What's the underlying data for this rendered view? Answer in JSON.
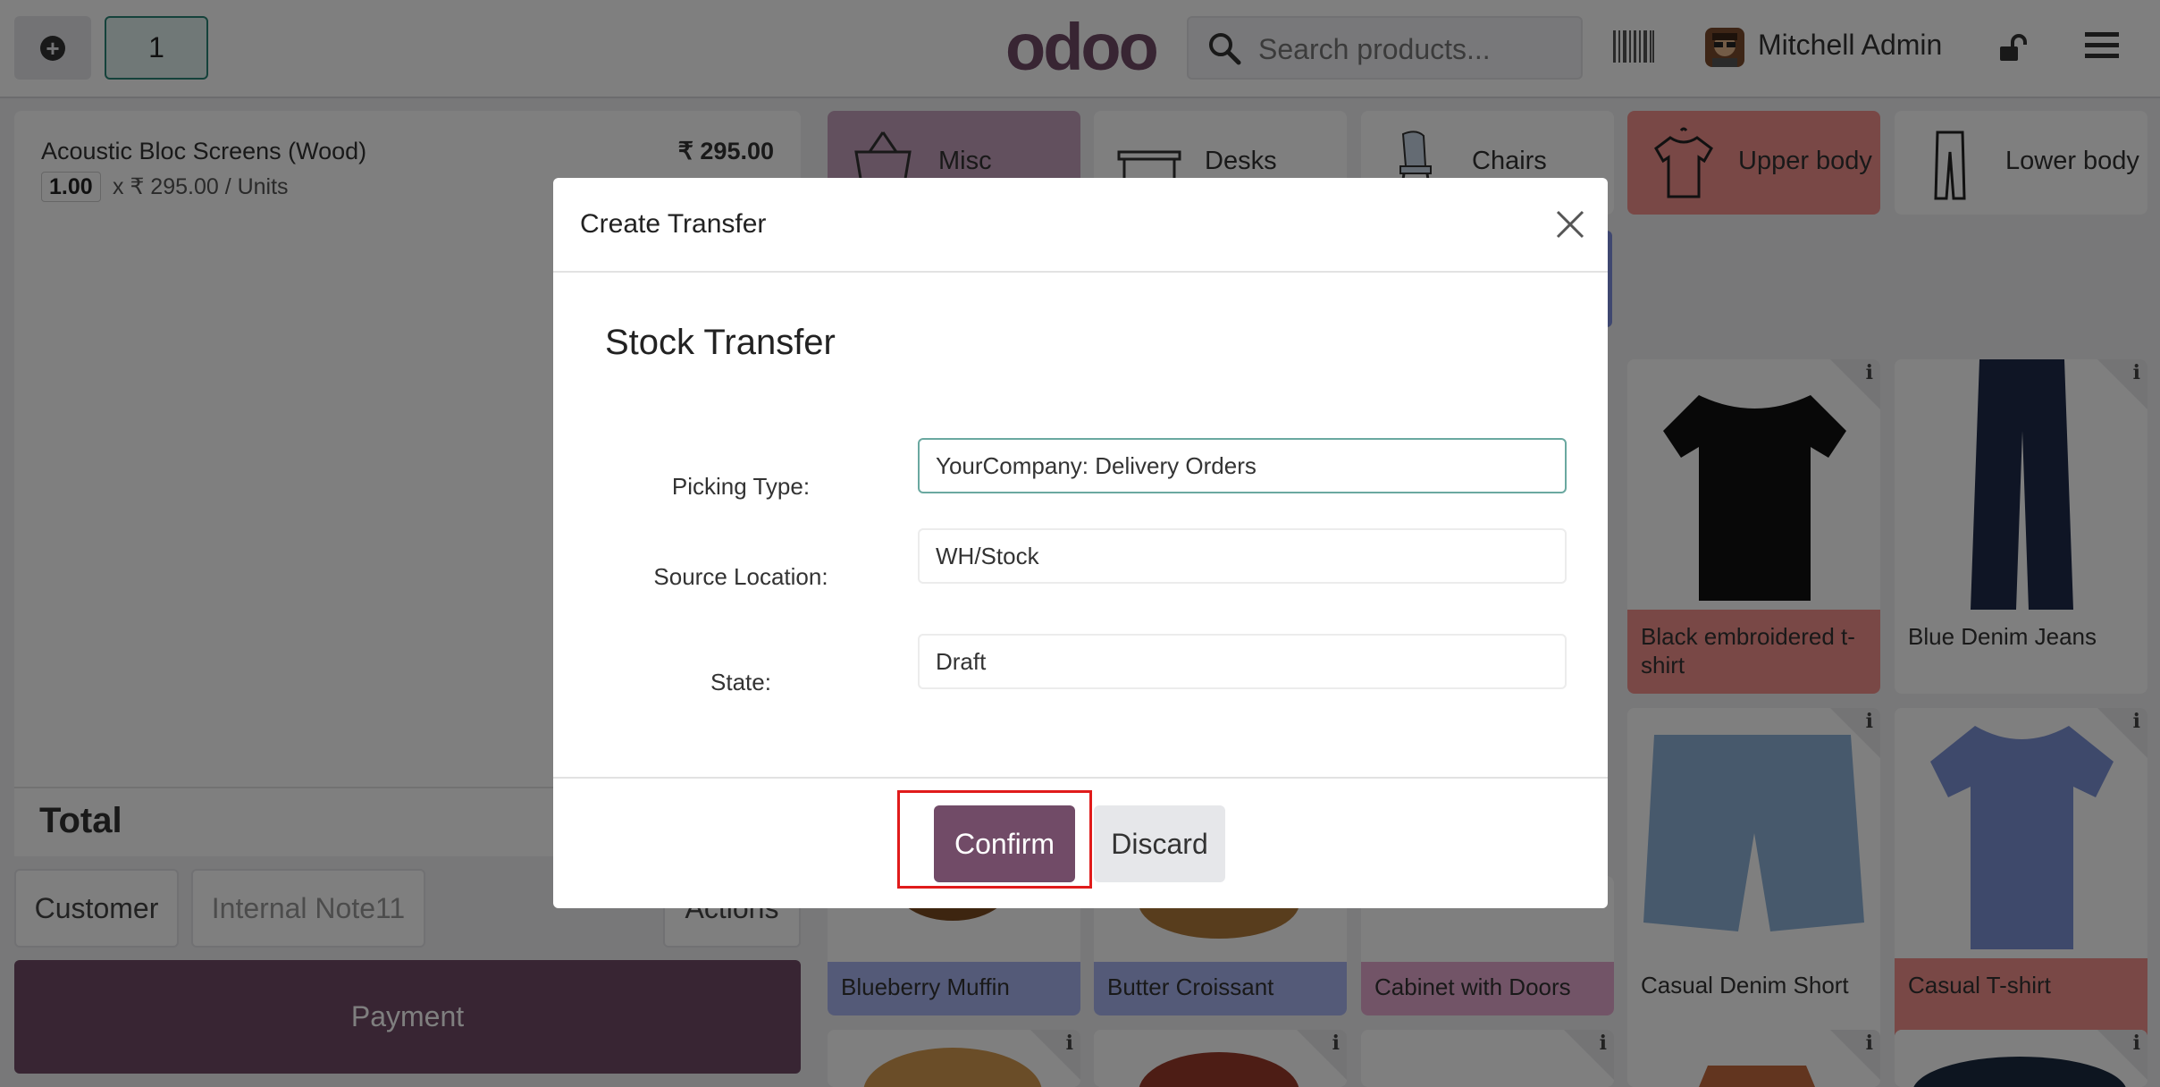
{
  "topbar": {
    "order_number": "1",
    "logo": "odoo",
    "search_placeholder": "Search products...",
    "user_name": "Mitchell Admin"
  },
  "order": {
    "line": {
      "name": "Acoustic Bloc Screens (Wood)",
      "price": "₹ 295.00",
      "qty": "1.00",
      "unit": "x ₹ 295.00 / Units"
    },
    "total_label": "Total"
  },
  "controls": {
    "customer": "Customer",
    "internal_note": "Internal Note11",
    "actions": "Actions",
    "payment": "Payment"
  },
  "categories": [
    {
      "label": "Misc",
      "icon": "basket-icon",
      "color": "#c5a0bc"
    },
    {
      "label": "Desks",
      "icon": "desk-icon",
      "color": "#ffffff"
    },
    {
      "label": "Chairs",
      "icon": "chair-icon",
      "color": "#ffffff"
    },
    {
      "label": "Upper body",
      "icon": "tshirt-icon",
      "color": "#f2908c"
    },
    {
      "label": "Lower body",
      "icon": "trousers-icon",
      "color": "#ffffff"
    }
  ],
  "products": [
    {
      "label": "Black embroidered t-shirt",
      "color": "#f2908c"
    },
    {
      "label": "Blue Denim Jeans",
      "color": "#ffffff"
    },
    {
      "label": "Blueberry Muffin",
      "color": "#a9b4f0"
    },
    {
      "label": "Butter Croissant",
      "color": "#a9b4f0"
    },
    {
      "label": "Cabinet with Doors",
      "color": "#e5a8cf"
    },
    {
      "label": "Casual Denim Short",
      "color": "#ffffff"
    },
    {
      "label": "Casual T-shirt",
      "color": "#f2908c"
    }
  ],
  "dialog": {
    "title": "Create Transfer",
    "heading": "Stock Transfer",
    "fields": [
      {
        "label": "Picking Type:",
        "value": "YourCompany: Delivery Orders"
      },
      {
        "label": "Source Location:",
        "value": "WH/Stock"
      },
      {
        "label": "State:",
        "value": "Draft"
      }
    ],
    "confirm": "Confirm",
    "discard": "Discard"
  },
  "colors": {
    "brand": "#714b67",
    "highlight": "#e01b1b"
  }
}
